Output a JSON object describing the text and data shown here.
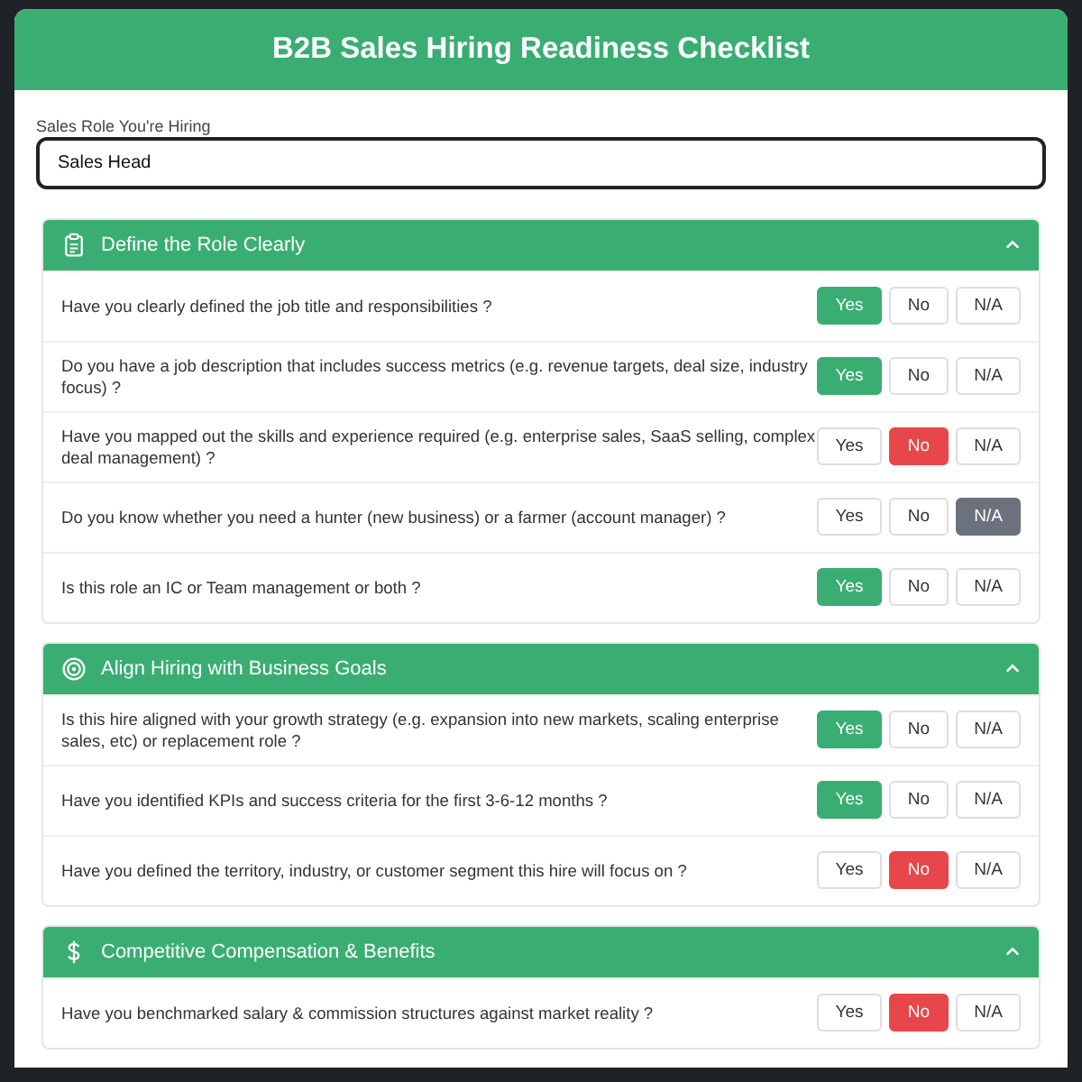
{
  "title": "B2B Sales Hiring Readiness Checklist",
  "role_field": {
    "label": "Sales Role You're Hiring",
    "value": "Sales Head"
  },
  "sections": [
    {
      "title": "Define the Role Clearly",
      "kind": "clipboard",
      "expanded": true,
      "questions": [
        {
          "text": "Have you clearly defined the job title and responsibilities ?",
          "options": [
            {
              "label": "Yes",
              "kind": "yes",
              "selected": true
            },
            {
              "label": "No",
              "kind": "no",
              "selected": false
            },
            {
              "label": "N/A",
              "kind": "na",
              "selected": false
            }
          ]
        },
        {
          "text": "Do you have a job description that includes success metrics (e.g. revenue targets, deal size, industry focus) ?",
          "options": [
            {
              "label": "Yes",
              "kind": "yes",
              "selected": true
            },
            {
              "label": "No",
              "kind": "no",
              "selected": false
            },
            {
              "label": "N/A",
              "kind": "na",
              "selected": false
            }
          ]
        },
        {
          "text": "Have you mapped out the skills and experience required (e.g. enterprise sales, SaaS selling, complex deal management) ?",
          "options": [
            {
              "label": "Yes",
              "kind": "yes",
              "selected": false
            },
            {
              "label": "No",
              "kind": "no",
              "selected": true
            },
            {
              "label": "N/A",
              "kind": "na",
              "selected": false
            }
          ]
        },
        {
          "text": "Do you know whether you need a hunter (new business) or a farmer (account manager) ?",
          "options": [
            {
              "label": "Yes",
              "kind": "yes",
              "selected": false
            },
            {
              "label": "No",
              "kind": "no",
              "selected": false
            },
            {
              "label": "N/A",
              "kind": "na",
              "selected": true
            }
          ]
        },
        {
          "text": "Is this role an IC or Team management or both ?",
          "options": [
            {
              "label": "Yes",
              "kind": "yes",
              "selected": true
            },
            {
              "label": "No",
              "kind": "no",
              "selected": false
            },
            {
              "label": "N/A",
              "kind": "na",
              "selected": false
            }
          ]
        }
      ]
    },
    {
      "title": "Align Hiring with Business Goals",
      "kind": "target",
      "expanded": true,
      "questions": [
        {
          "text": "Is this hire aligned with your growth strategy (e.g. expansion into new markets, scaling enterprise sales, etc) or replacement role ?",
          "options": [
            {
              "label": "Yes",
              "kind": "yes",
              "selected": true
            },
            {
              "label": "No",
              "kind": "no",
              "selected": false
            },
            {
              "label": "N/A",
              "kind": "na",
              "selected": false
            }
          ]
        },
        {
          "text": "Have you identified KPIs and success criteria for the first 3-6-12 months ?",
          "options": [
            {
              "label": "Yes",
              "kind": "yes",
              "selected": true
            },
            {
              "label": "No",
              "kind": "no",
              "selected": false
            },
            {
              "label": "N/A",
              "kind": "na",
              "selected": false
            }
          ]
        },
        {
          "text": "Have you defined the territory, industry, or customer segment this hire will focus on ?",
          "options": [
            {
              "label": "Yes",
              "kind": "yes",
              "selected": false
            },
            {
              "label": "No",
              "kind": "no",
              "selected": true
            },
            {
              "label": "N/A",
              "kind": "na",
              "selected": false
            }
          ]
        }
      ]
    },
    {
      "title": "Competitive Compensation & Benefits",
      "kind": "dollar",
      "expanded": true,
      "questions": [
        {
          "text": "Have you benchmarked salary & commission structures against market reality ?",
          "options": [
            {
              "label": "Yes",
              "kind": "yes",
              "selected": false
            },
            {
              "label": "No",
              "kind": "no",
              "selected": true
            },
            {
              "label": "N/A",
              "kind": "na",
              "selected": false
            }
          ]
        }
      ]
    }
  ]
}
